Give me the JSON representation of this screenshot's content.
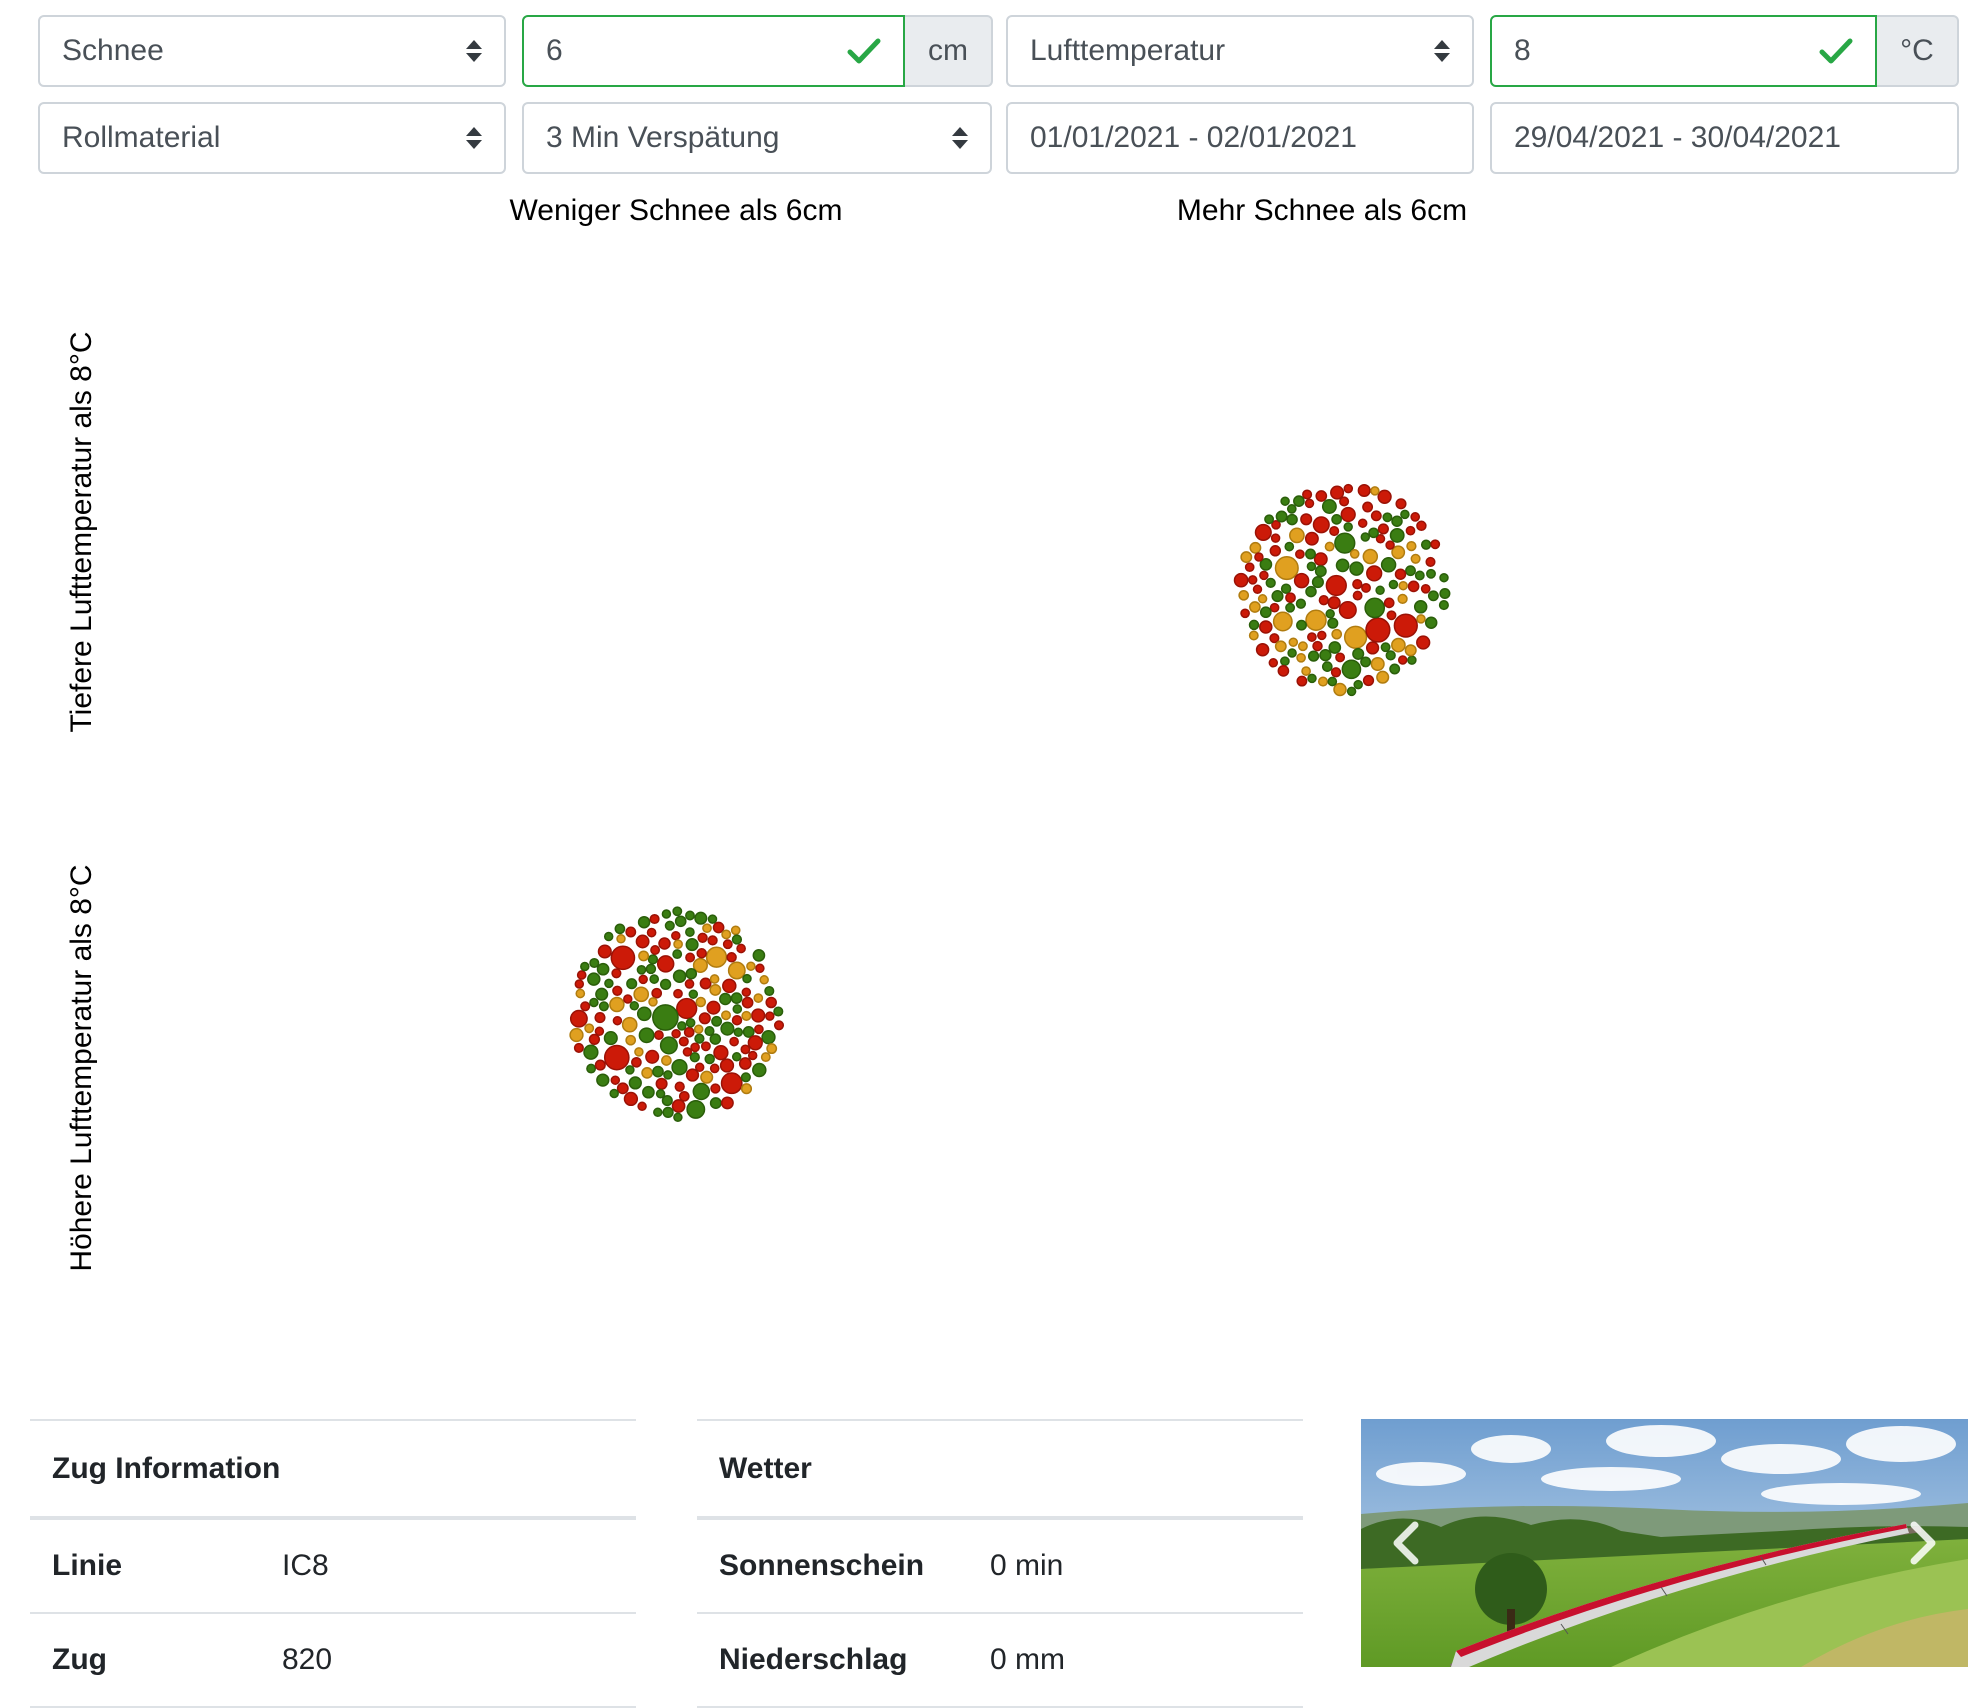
{
  "filters": {
    "variable1": {
      "selected": "Schnee"
    },
    "threshold1": {
      "value": "6",
      "unit": "cm"
    },
    "variable2": {
      "selected": "Lufttemperatur"
    },
    "threshold2": {
      "value": "8",
      "unit": "°C"
    },
    "category": {
      "selected": "Rollmaterial"
    },
    "delay": {
      "selected": "3 Min Verspätung"
    },
    "date_range1": {
      "value": "01/01/2021 - 02/01/2021"
    },
    "date_range2": {
      "value": "29/04/2021 - 30/04/2021"
    }
  },
  "chart": {
    "col_labels": [
      "Weniger Schnee als 6cm",
      "Mehr Schnee als 6cm"
    ],
    "row_labels": [
      "Tiefere Lufttemperatur als 8°C",
      "Höhere Lufttemperatur als 8°C"
    ]
  },
  "chart_data": {
    "type": "scatter",
    "colors": {
      "on_time": "#3a7d12",
      "slight_delay": "#e0a020",
      "delay": "#cc1a08"
    },
    "clusters": [
      {
        "col": "Mehr Schnee als 6cm",
        "row": "Tiefere Lufttemperatur als 8°C",
        "count": 170,
        "seed": 7
      },
      {
        "col": "Weniger Schnee als 6cm",
        "row": "Höhere Lufttemperatur als 8°C",
        "count": 190,
        "seed": 21
      }
    ]
  },
  "info": {
    "train": {
      "title": "Zug Information",
      "rows": [
        {
          "key": "Linie",
          "value": "IC8"
        },
        {
          "key": "Zug",
          "value": "820"
        }
      ]
    },
    "weather": {
      "title": "Wetter",
      "rows": [
        {
          "key": "Sonnenschein",
          "value": "0 min"
        },
        {
          "key": "Niederschlag",
          "value": "0 mm"
        }
      ]
    }
  },
  "icons": {
    "valid": "check-icon",
    "select": "sort-arrows-icon",
    "prev": "chevron-left-icon",
    "next": "chevron-right-icon"
  }
}
